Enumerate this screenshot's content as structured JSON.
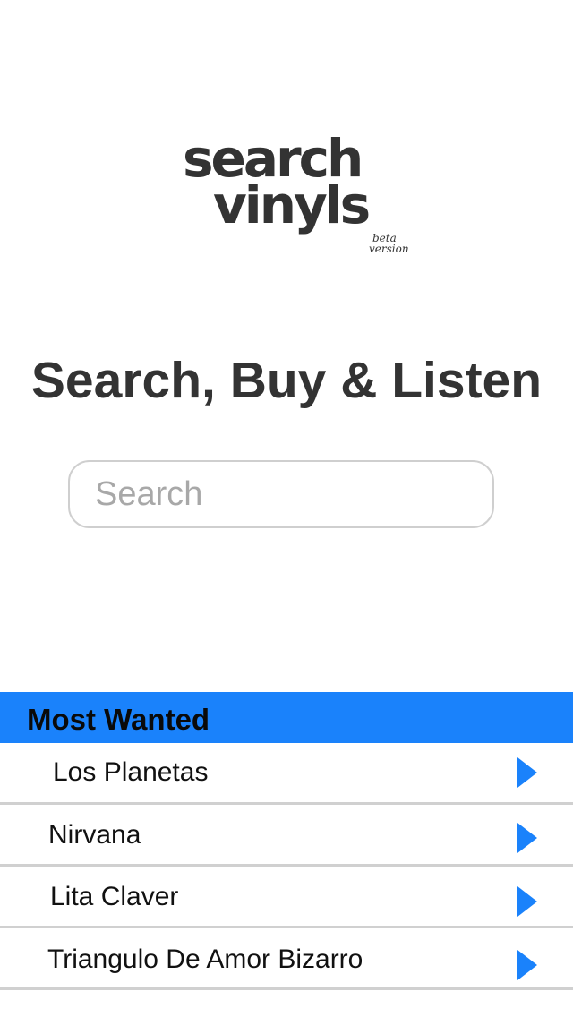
{
  "logo": {
    "line1": "search",
    "line2": "vinyls",
    "badge_line1": "beta",
    "badge_line2": "version"
  },
  "tagline": "Search, Buy & Listen",
  "search": {
    "placeholder": "Search",
    "value": ""
  },
  "most_wanted": {
    "header": "Most Wanted",
    "items": [
      {
        "label": "Los Planetas",
        "icon": "play-arrow-icon"
      },
      {
        "label": "Nirvana",
        "icon": "play-arrow-icon"
      },
      {
        "label": "Lita Claver",
        "icon": "play-arrow-icon"
      },
      {
        "label": "Triangulo De Amor Bizarro",
        "icon": "play-arrow-icon"
      }
    ]
  },
  "colors": {
    "accent": "#1a82fb",
    "logo_text": "#333333",
    "divider": "#d0d0d0"
  }
}
